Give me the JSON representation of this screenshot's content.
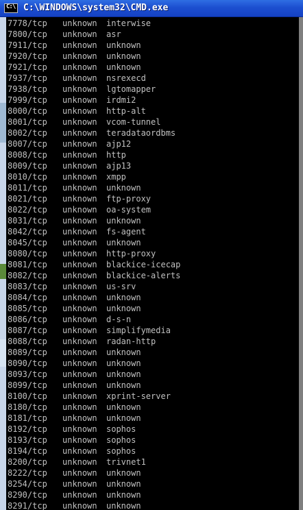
{
  "window": {
    "title": "C:\\WINDOWS\\system32\\CMD.exe",
    "icon_label": "C:\\"
  },
  "rows": [
    {
      "port": "7778/tcp",
      "state": "unknown",
      "service": "interwise"
    },
    {
      "port": "7800/tcp",
      "state": "unknown",
      "service": "asr"
    },
    {
      "port": "7911/tcp",
      "state": "unknown",
      "service": "unknown"
    },
    {
      "port": "7920/tcp",
      "state": "unknown",
      "service": "unknown"
    },
    {
      "port": "7921/tcp",
      "state": "unknown",
      "service": "unknown"
    },
    {
      "port": "7937/tcp",
      "state": "unknown",
      "service": "nsrexecd"
    },
    {
      "port": "7938/tcp",
      "state": "unknown",
      "service": "lgtomapper"
    },
    {
      "port": "7999/tcp",
      "state": "unknown",
      "service": "irdmi2"
    },
    {
      "port": "8000/tcp",
      "state": "unknown",
      "service": "http-alt"
    },
    {
      "port": "8001/tcp",
      "state": "unknown",
      "service": "vcom-tunnel"
    },
    {
      "port": "8002/tcp",
      "state": "unknown",
      "service": "teradataordbms"
    },
    {
      "port": "8007/tcp",
      "state": "unknown",
      "service": "ajp12"
    },
    {
      "port": "8008/tcp",
      "state": "unknown",
      "service": "http"
    },
    {
      "port": "8009/tcp",
      "state": "unknown",
      "service": "ajp13"
    },
    {
      "port": "8010/tcp",
      "state": "unknown",
      "service": "xmpp"
    },
    {
      "port": "8011/tcp",
      "state": "unknown",
      "service": "unknown"
    },
    {
      "port": "8021/tcp",
      "state": "unknown",
      "service": "ftp-proxy"
    },
    {
      "port": "8022/tcp",
      "state": "unknown",
      "service": "oa-system"
    },
    {
      "port": "8031/tcp",
      "state": "unknown",
      "service": "unknown"
    },
    {
      "port": "8042/tcp",
      "state": "unknown",
      "service": "fs-agent"
    },
    {
      "port": "8045/tcp",
      "state": "unknown",
      "service": "unknown"
    },
    {
      "port": "8080/tcp",
      "state": "unknown",
      "service": "http-proxy"
    },
    {
      "port": "8081/tcp",
      "state": "unknown",
      "service": "blackice-icecap"
    },
    {
      "port": "8082/tcp",
      "state": "unknown",
      "service": "blackice-alerts"
    },
    {
      "port": "8083/tcp",
      "state": "unknown",
      "service": "us-srv"
    },
    {
      "port": "8084/tcp",
      "state": "unknown",
      "service": "unknown"
    },
    {
      "port": "8085/tcp",
      "state": "unknown",
      "service": "unknown"
    },
    {
      "port": "8086/tcp",
      "state": "unknown",
      "service": "d-s-n"
    },
    {
      "port": "8087/tcp",
      "state": "unknown",
      "service": "simplifymedia"
    },
    {
      "port": "8088/tcp",
      "state": "unknown",
      "service": "radan-http"
    },
    {
      "port": "8089/tcp",
      "state": "unknown",
      "service": "unknown"
    },
    {
      "port": "8090/tcp",
      "state": "unknown",
      "service": "unknown"
    },
    {
      "port": "8093/tcp",
      "state": "unknown",
      "service": "unknown"
    },
    {
      "port": "8099/tcp",
      "state": "unknown",
      "service": "unknown"
    },
    {
      "port": "8100/tcp",
      "state": "unknown",
      "service": "xprint-server"
    },
    {
      "port": "8180/tcp",
      "state": "unknown",
      "service": "unknown"
    },
    {
      "port": "8181/tcp",
      "state": "unknown",
      "service": "unknown"
    },
    {
      "port": "8192/tcp",
      "state": "unknown",
      "service": "sophos"
    },
    {
      "port": "8193/tcp",
      "state": "unknown",
      "service": "sophos"
    },
    {
      "port": "8194/tcp",
      "state": "unknown",
      "service": "sophos"
    },
    {
      "port": "8200/tcp",
      "state": "unknown",
      "service": "trivnet1"
    },
    {
      "port": "8222/tcp",
      "state": "unknown",
      "service": "unknown"
    },
    {
      "port": "8254/tcp",
      "state": "unknown",
      "service": "unknown"
    },
    {
      "port": "8290/tcp",
      "state": "unknown",
      "service": "unknown"
    },
    {
      "port": "8291/tcp",
      "state": "unknown",
      "service": "unknown"
    }
  ]
}
